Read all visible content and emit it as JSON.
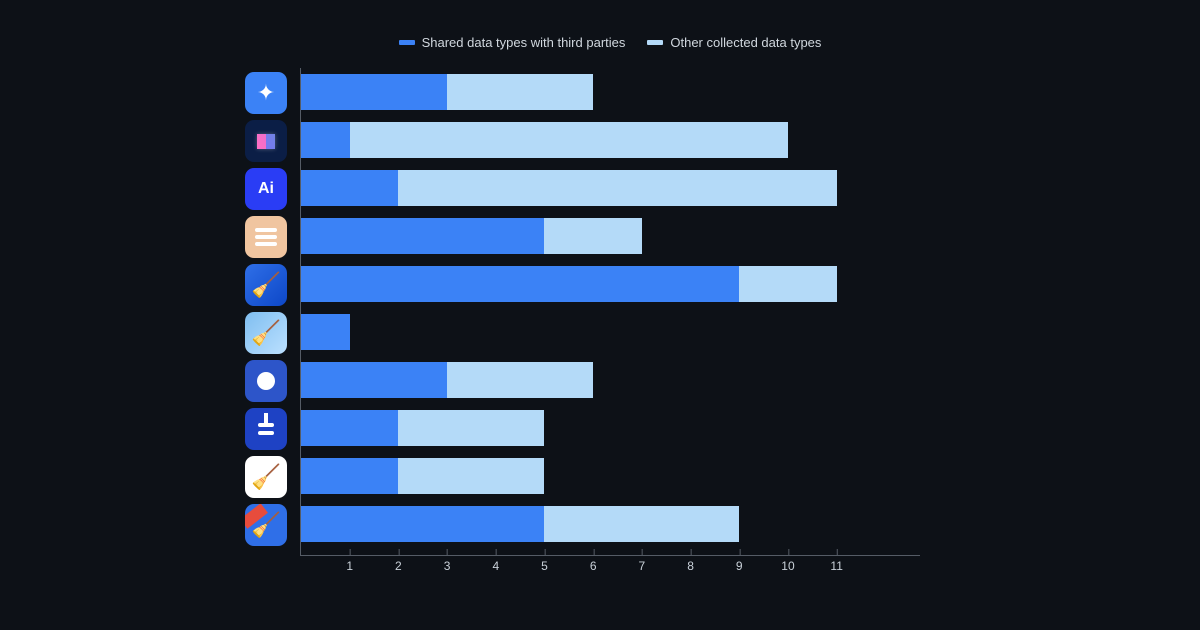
{
  "legend": {
    "shared": "Shared data types with third parties",
    "other": "Other collected data types"
  },
  "x_ticks": [
    1,
    2,
    3,
    4,
    5,
    6,
    7,
    8,
    9,
    10,
    11
  ],
  "x_max": 11.5,
  "chart_data": {
    "type": "bar",
    "orientation": "horizontal",
    "stacked": true,
    "title": "",
    "xlabel": "",
    "ylabel": "",
    "xlim": [
      0,
      11.5
    ],
    "categories": [
      "app-sparkle",
      "app-recycle",
      "app-ai",
      "app-stack-peach",
      "app-broom-blue",
      "app-broom-light",
      "app-robot-clean",
      "app-brush-t",
      "app-broom-white",
      "app-broom-banner"
    ],
    "series": [
      {
        "name": "Shared data types with third parties",
        "values": [
          3,
          1,
          2,
          5,
          9,
          1,
          3,
          2,
          2,
          5
        ]
      },
      {
        "name": "Other collected data types",
        "values": [
          3,
          9,
          9,
          2,
          2,
          0,
          3,
          3,
          3,
          4
        ]
      }
    ],
    "icons": [
      {
        "name": "sparkle-icon",
        "bg": "#3b82f6"
      },
      {
        "name": "recycle-icon",
        "bg": "#0b1e46"
      },
      {
        "name": "ai-icon",
        "bg": "#2a3df5",
        "text": "Ai"
      },
      {
        "name": "stack-icon",
        "bg": "#f0c5a0"
      },
      {
        "name": "broom-icon",
        "bg": "#2f6fe8"
      },
      {
        "name": "broom-light-icon",
        "bg": "#bbe0ff"
      },
      {
        "name": "robot-icon",
        "bg": "#2d55c9"
      },
      {
        "name": "brush-icon",
        "bg": "#1e42c4"
      },
      {
        "name": "broom-white-icon",
        "bg": "#ffffff"
      },
      {
        "name": "broom-banner-icon",
        "bg": "#2f6fe8"
      }
    ]
  }
}
